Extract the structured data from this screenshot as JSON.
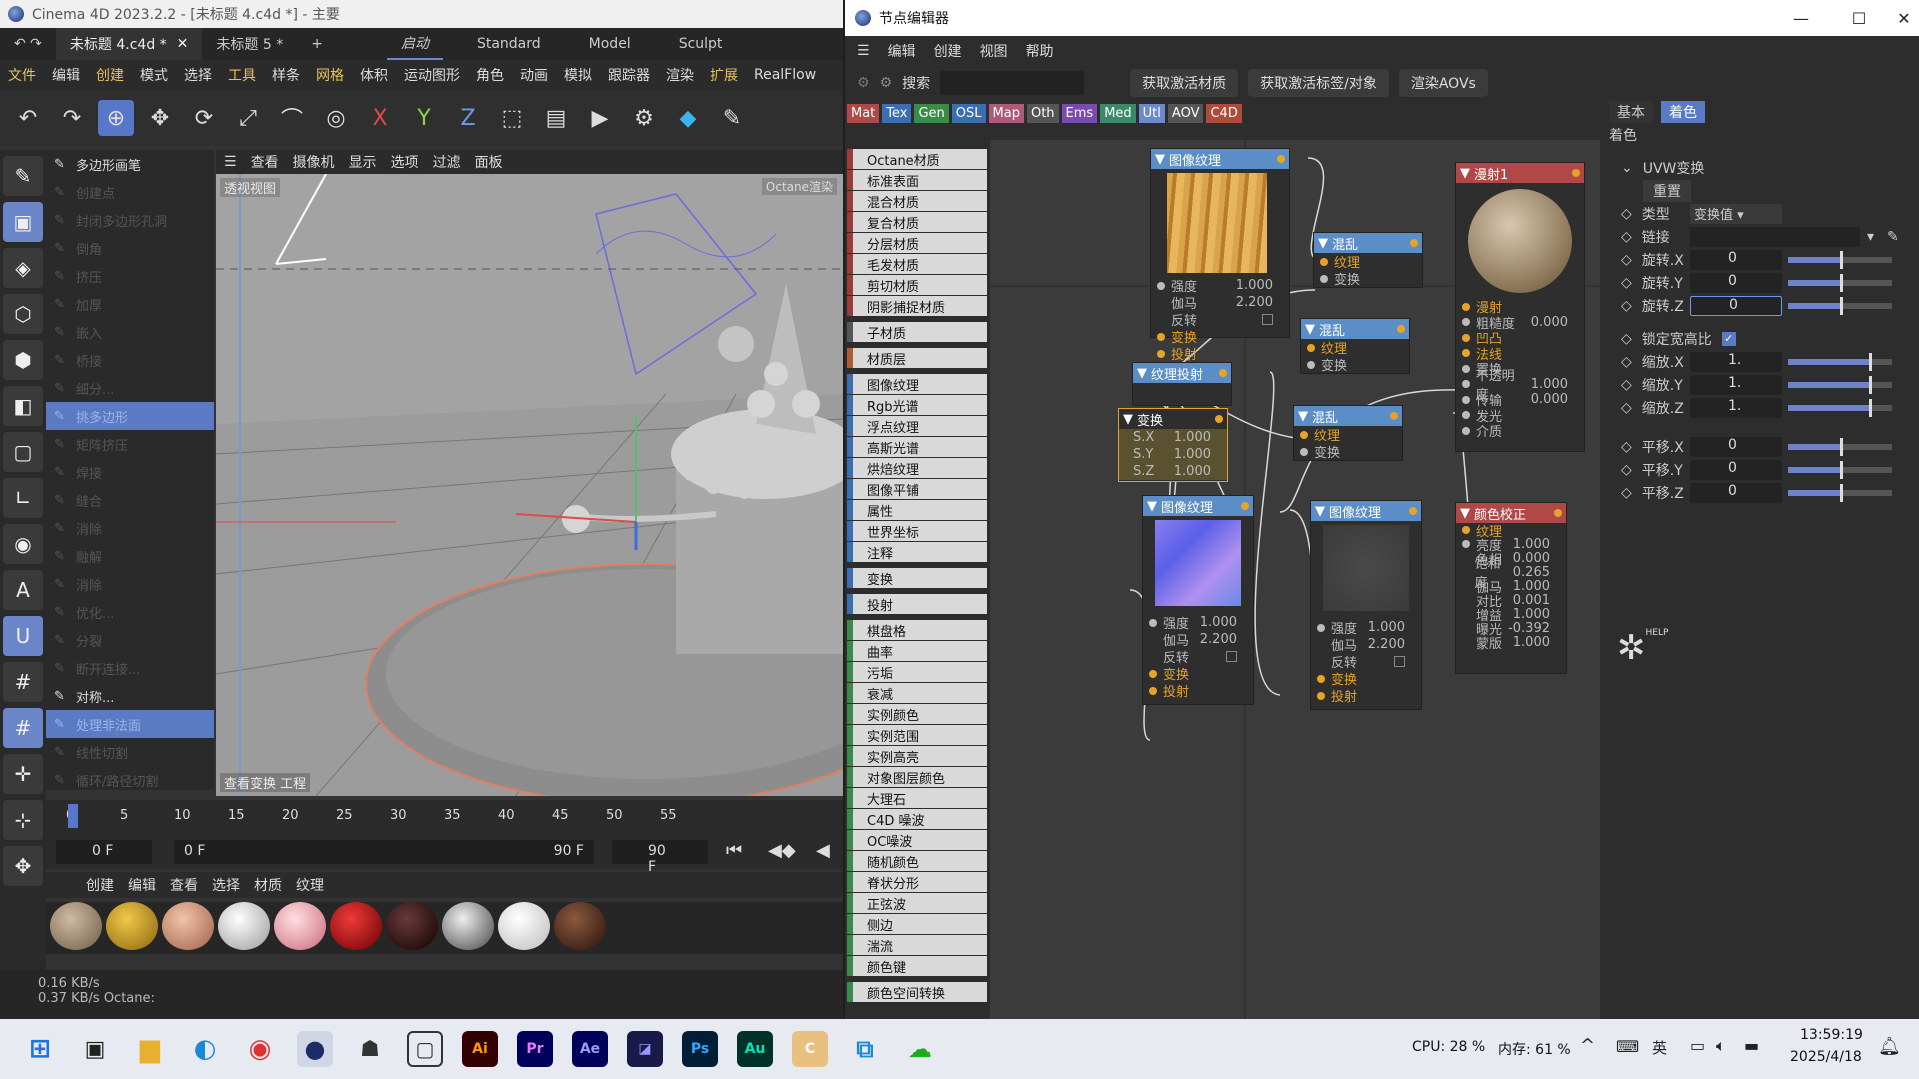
{
  "c4d": {
    "title": "Cinema 4D 2023.2.2 - [未标题 4.c4d *] - 主要",
    "tab1": "未标题 4.c4d *",
    "tab2": "未标题 5 *",
    "layouts": [
      "启动",
      "Standard",
      "Model",
      "Sculpt"
    ],
    "menu": [
      "文件",
      "编辑",
      "创建",
      "模式",
      "选择",
      "工具",
      "样条",
      "网格",
      "体积",
      "运动图形",
      "角色",
      "动画",
      "模拟",
      "跟踪器",
      "渲染",
      "扩展",
      "RealFlow"
    ],
    "viewport_menu": [
      "查看",
      "摄像机",
      "显示",
      "选项",
      "过滤",
      "面板"
    ],
    "viewport_label": "透视视图",
    "viewport_corner": "Octane渲染",
    "viewport_bottom": "查看变换   工程",
    "mesh_tools": [
      "多边形画笔",
      "创建点",
      "封闭多边形孔洞",
      "倒角",
      "挤压",
      "加厚",
      "嵌入",
      "桥接",
      "细分...",
      "挑多边形",
      "矩阵挤压",
      "焊接",
      "缝合",
      "消除",
      "融解",
      "消除",
      "优化...",
      "分裂",
      "断开连接...",
      "对称...",
      "处理非法面",
      "线性切割",
      "循环/路径切割"
    ],
    "timeline_ticks": [
      "0",
      "5",
      "10",
      "15",
      "20",
      "25",
      "30",
      "35",
      "40",
      "45",
      "50",
      "55"
    ],
    "frame_start": "0 F",
    "frame_cur": "0 F",
    "frame_end1": "90 F",
    "frame_end2": "90 F",
    "mat_menu": [
      "创建",
      "编辑",
      "查看",
      "选择",
      "材质",
      "纹理"
    ],
    "status1": "0.16 KB/s",
    "status2": "0.37 KB/s",
    "status3": "Octane:"
  },
  "ne": {
    "title": "节点编辑器",
    "menu": [
      "编辑",
      "创建",
      "视图",
      "帮助"
    ],
    "search_label": "搜索",
    "btn1": "获取激活材质",
    "btn2": "获取激活标签/对象",
    "btn3": "渲染AOVs",
    "cats": [
      "Mat",
      "Tex",
      "Gen",
      "OSL",
      "Map",
      "Oth",
      "Ems",
      "Med",
      "Utl",
      "AOV",
      "C4D"
    ],
    "node_list": [
      {
        "t": "Octane材质",
        "c": "#9b3a3a"
      },
      {
        "t": "标准表面",
        "c": "#9b3a3a"
      },
      {
        "t": "混合材质",
        "c": "#9b3a3a"
      },
      {
        "t": "复合材质",
        "c": "#9b3a3a"
      },
      {
        "t": "分层材质",
        "c": "#9b3a3a"
      },
      {
        "t": "毛发材质",
        "c": "#9b3a3a"
      },
      {
        "t": "剪切材质",
        "c": "#9b3a3a"
      },
      {
        "t": "阴影捕捉材质",
        "c": "#9b3a3a"
      },
      {
        "t": "子材质",
        "c": "#555",
        "gap": true
      },
      {
        "t": "材质层",
        "c": "#b05a3a",
        "gap": true
      },
      {
        "t": "图像纹理",
        "c": "#3a6eb0",
        "gap": true
      },
      {
        "t": "Rgb光谱",
        "c": "#3a6eb0"
      },
      {
        "t": "浮点纹理",
        "c": "#3a6eb0"
      },
      {
        "t": "高斯光谱",
        "c": "#3a6eb0"
      },
      {
        "t": "烘焙纹理",
        "c": "#3a6eb0"
      },
      {
        "t": "图像平铺",
        "c": "#3a6eb0"
      },
      {
        "t": "属性",
        "c": "#3a6eb0"
      },
      {
        "t": "世界坐标",
        "c": "#3a6eb0"
      },
      {
        "t": "注释",
        "c": "#3a6eb0"
      },
      {
        "t": "变换",
        "c": "#3a6eb0",
        "gap": true
      },
      {
        "t": "投射",
        "c": "#3a6eb0",
        "gap": true
      },
      {
        "t": "棋盘格",
        "c": "#3a8a4a",
        "gap": true
      },
      {
        "t": "曲率",
        "c": "#3a8a4a"
      },
      {
        "t": "污垢",
        "c": "#3a8a4a"
      },
      {
        "t": "衰减",
        "c": "#3a8a4a"
      },
      {
        "t": "实例颜色",
        "c": "#3a8a4a"
      },
      {
        "t": "实例范围",
        "c": "#3a8a4a"
      },
      {
        "t": "实例高亮",
        "c": "#3a8a4a"
      },
      {
        "t": "对象图层颜色",
        "c": "#3a8a4a"
      },
      {
        "t": "大理石",
        "c": "#3a8a4a"
      },
      {
        "t": "C4D 噪波",
        "c": "#3a8a4a"
      },
      {
        "t": "OC噪波",
        "c": "#3a8a4a"
      },
      {
        "t": "随机颜色",
        "c": "#3a8a4a"
      },
      {
        "t": "脊状分形",
        "c": "#3a8a4a"
      },
      {
        "t": "正弦波",
        "c": "#3a8a4a"
      },
      {
        "t": "侧边",
        "c": "#3a8a4a"
      },
      {
        "t": "湍流",
        "c": "#3a8a4a"
      },
      {
        "t": "颜色键",
        "c": "#3a8a4a"
      },
      {
        "t": "颜色空间转换",
        "c": "#3a8a4a",
        "gap": true
      }
    ],
    "nodes": {
      "img1": {
        "title": "图像纹理",
        "strength_l": "强度",
        "strength": "1.000",
        "gamma_l": "伽马",
        "gamma": "2.200",
        "invert_l": "反转",
        "xf": "变换",
        "proj": "投射"
      },
      "mix1": {
        "title": "混乱",
        "tex": "纹理",
        "xf": "变换"
      },
      "mix2": {
        "title": "混乱",
        "tex": "纹理",
        "xf": "变换"
      },
      "mix3": {
        "title": "混乱",
        "tex": "纹理",
        "xf": "变换"
      },
      "proj": {
        "title": "纹理投射"
      },
      "xform": {
        "title": "变换",
        "sx_l": "S.X",
        "sx": "1.000",
        "sy_l": "S.Y",
        "sy": "1.000",
        "sz_l": "S.Z",
        "sz": "1.000"
      },
      "img2": {
        "title": "图像纹理",
        "strength_l": "强度",
        "strength": "1.000",
        "gamma_l": "伽马",
        "gamma": "2.200",
        "invert_l": "反转",
        "xf": "变换",
        "proj": "投射"
      },
      "img3": {
        "title": "图像纹理",
        "strength_l": "强度",
        "strength": "1.000",
        "gamma_l": "伽马",
        "gamma": "2.200",
        "invert_l": "反转",
        "xf": "变换",
        "proj": "投射"
      },
      "diffuse": {
        "title": "漫射1",
        "rows": [
          {
            "l": "漫射",
            "v": "",
            "in": true
          },
          {
            "l": "粗糙度",
            "v": "0.000",
            "in": false
          },
          {
            "l": "凹凸",
            "v": "",
            "in": true
          },
          {
            "l": "法线",
            "v": "",
            "in": true
          },
          {
            "l": "置换",
            "v": "",
            "in": false
          },
          {
            "l": "不透明度",
            "v": "1.000",
            "in": false
          },
          {
            "l": "传输",
            "v": "0.000",
            "in": false
          },
          {
            "l": "发光",
            "v": "",
            "in": false
          },
          {
            "l": "介质",
            "v": "",
            "in": false
          }
        ]
      },
      "cc": {
        "title": "颜色校正",
        "rows": [
          {
            "l": "纹理",
            "v": "",
            "in": true
          },
          {
            "l": "亮度",
            "v": "1.000"
          },
          {
            "l": "色相",
            "v": "0.000"
          },
          {
            "l": "饱和度",
            "v": "0.265"
          },
          {
            "l": "伽马",
            "v": "1.000"
          },
          {
            "l": "对比",
            "v": "0.001"
          },
          {
            "l": "增益",
            "v": "1.000"
          },
          {
            "l": "曝光",
            "v": "-0.392"
          },
          {
            "l": "蒙版",
            "v": "1.000"
          }
        ]
      }
    },
    "props": {
      "tab_basic": "基本",
      "tab_shade": "着色",
      "section": "着色",
      "group": "UVW变换",
      "reset": "重置",
      "type_l": "类型",
      "type_v": "变换值",
      "link_l": "链接",
      "rx_l": "旋转.X",
      "rx": "0",
      "ry_l": "旋转.Y",
      "ry": "0",
      "rz_l": "旋转.Z",
      "rz": "0",
      "lock_l": "锁定宽高比",
      "scx_l": "缩放.X",
      "scx": "1.",
      "scy_l": "缩放.Y",
      "scy": "1.",
      "scz_l": "缩放.Z",
      "scz": "1.",
      "px_l": "平移.X",
      "px": "0",
      "py_l": "平移.Y",
      "py": "0",
      "pz_l": "平移.Z",
      "pz": "0",
      "help": "HELP"
    }
  },
  "taskbar": {
    "cpu": "CPU: 28 %",
    "mem": "内存: 61 %",
    "ime": "英",
    "time": "13:59:19",
    "date": "2025/4/18",
    "apps": [
      "Ai",
      "Pr",
      "Ae",
      "Ps",
      "Au"
    ]
  }
}
